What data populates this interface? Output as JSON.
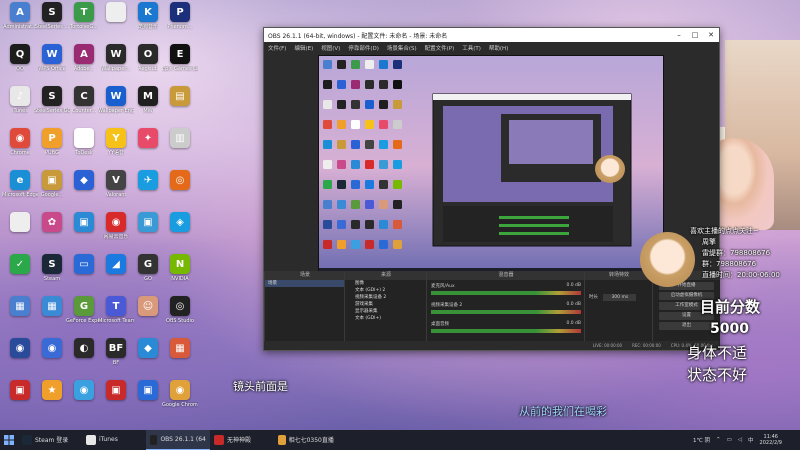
{
  "desktop": {
    "icons": [
      {
        "label": "Administrat...",
        "color": "#4a7fd0",
        "glyph": "A"
      },
      {
        "label": "SteelSeries ...",
        "color": "#222",
        "glyph": "S"
      },
      {
        "label": "TortoiseG...",
        "color": "#3b9b4a",
        "glyph": "T"
      },
      {
        "label": "",
        "color": "#eeeeee",
        "glyph": ""
      },
      {
        "label": "酷狗音乐",
        "color": "#1a78d0",
        "glyph": "K"
      },
      {
        "label": "Phenom...",
        "color": "#1b2f7a",
        "glyph": "P"
      },
      {
        "label": "QQ",
        "color": "#1d1d1d",
        "glyph": "Q"
      },
      {
        "label": "WPS Office",
        "color": "#2a62d6",
        "glyph": "W"
      },
      {
        "label": "Adobe...",
        "color": "#9a2a72",
        "glyph": "A"
      },
      {
        "label": "Wallpaper...",
        "color": "#2b2b2b",
        "glyph": "W"
      },
      {
        "label": "Aegisub",
        "color": "#2a2a2a",
        "glyph": "O"
      },
      {
        "label": "Epic Games Launcher",
        "color": "#111111",
        "glyph": "E"
      },
      {
        "label": "iTunes",
        "color": "#e8e8e8",
        "glyph": "♪"
      },
      {
        "label": "SteelSeries GG",
        "color": "#222222",
        "glyph": "S"
      },
      {
        "label": "Counter...",
        "color": "#333333",
        "glyph": "C"
      },
      {
        "label": "Wallpaper Engine",
        "color": "#1a5fd0",
        "glyph": "W"
      },
      {
        "label": "MW",
        "color": "#202020",
        "glyph": "M"
      },
      {
        "label": "",
        "color": "#c89a3a",
        "glyph": "▤"
      },
      {
        "label": "Chrome",
        "color": "#e04a3a",
        "glyph": "◉"
      },
      {
        "label": "PUBG",
        "color": "#f0a02a",
        "glyph": "P"
      },
      {
        "label": "ToDesk",
        "color": "#ffffff",
        "glyph": "▣"
      },
      {
        "label": "YY语音",
        "color": "#f6c21a",
        "glyph": "Y"
      },
      {
        "label": "",
        "color": "#e84a6a",
        "glyph": "✦"
      },
      {
        "label": "",
        "color": "#cccccc",
        "glyph": "▥"
      },
      {
        "label": "Microsoft Edge",
        "color": "#1b8fd6",
        "glyph": "e"
      },
      {
        "label": "Google...",
        "color": "#c89a3a",
        "glyph": "▣"
      },
      {
        "label": "",
        "color": "#2a62d6",
        "glyph": "◆"
      },
      {
        "label": "Valorant",
        "color": "#444444",
        "glyph": "V"
      },
      {
        "label": "",
        "color": "#1a9ce0",
        "glyph": "✈"
      },
      {
        "label": "",
        "color": "#e46a1a",
        "glyph": "◎"
      },
      {
        "label": "",
        "color": "#eeeeee",
        "glyph": ""
      },
      {
        "label": "",
        "color": "#c94a8a",
        "glyph": "✿"
      },
      {
        "label": "",
        "color": "#2a8ad6",
        "glyph": "▣"
      },
      {
        "label": "网易云音乐",
        "color": "#d82a2a",
        "glyph": "◉"
      },
      {
        "label": "",
        "color": "#3a9ad6",
        "glyph": "▣"
      },
      {
        "label": "",
        "color": "#1a9ce0",
        "glyph": "◈"
      },
      {
        "label": "",
        "color": "#2aa84a",
        "glyph": "✓"
      },
      {
        "label": "Steam",
        "color": "#1b2838",
        "glyph": "S"
      },
      {
        "label": "",
        "color": "#2a6ad6",
        "glyph": "▭"
      },
      {
        "label": "",
        "color": "#1a7ae0",
        "glyph": "◢"
      },
      {
        "label": "GO",
        "color": "#333333",
        "glyph": "G"
      },
      {
        "label": "NVIDIA",
        "color": "#76b900",
        "glyph": "N"
      },
      {
        "label": "",
        "color": "#4a7fd0",
        "glyph": "▦"
      },
      {
        "label": "",
        "color": "#3a8ad6",
        "glyph": "▦"
      },
      {
        "label": "GeForce Experience",
        "color": "#5a9a3a",
        "glyph": "G"
      },
      {
        "label": "Microsoft Teams",
        "color": "#4a5ad6",
        "glyph": "T"
      },
      {
        "label": "",
        "color": "#d89a7a",
        "glyph": "☺"
      },
      {
        "label": "OBS Studio",
        "color": "#222222",
        "glyph": "◎"
      },
      {
        "label": "",
        "color": "#2a4a9a",
        "glyph": "◉"
      },
      {
        "label": "",
        "color": "#3a6ad6",
        "glyph": "◉"
      },
      {
        "label": "",
        "color": "#2a2a2a",
        "glyph": "◐"
      },
      {
        "label": "BF",
        "color": "#2a2a2a",
        "glyph": "BF"
      },
      {
        "label": "",
        "color": "#2a8ad6",
        "glyph": "◆"
      },
      {
        "label": "",
        "color": "#d85a3a",
        "glyph": "▦"
      },
      {
        "label": "",
        "color": "#c82a2a",
        "glyph": "▣"
      },
      {
        "label": "",
        "color": "#f0a02a",
        "glyph": "★"
      },
      {
        "label": "",
        "color": "#3aa0e0",
        "glyph": "◉"
      },
      {
        "label": "",
        "color": "#c82a2a",
        "glyph": "▣"
      },
      {
        "label": "",
        "color": "#2a6ad6",
        "glyph": "▣"
      },
      {
        "label": "Google Chrome",
        "color": "#e0a03a",
        "glyph": "◉"
      }
    ]
  },
  "obs": {
    "title": "OBS 26.1.1 (64-bit, windows) - 配置文件: 未命名 - 场景: 未命名",
    "menu": [
      "文件(F)",
      "编辑(E)",
      "视图(V)",
      "停靠部件(D)",
      "场景集合(S)",
      "配置文件(P)",
      "工具(T)",
      "帮助(H)"
    ],
    "docks": {
      "scenes_title": "场景",
      "scene_item": "场景",
      "sources_title": "来源",
      "sources": [
        "图像",
        "文本 (GDI+) 2",
        "视频采集设备 2",
        "游戏采集",
        "显示器采集",
        "文本 (GDI+)"
      ],
      "mixer_title": "混音器",
      "mixer": [
        {
          "name": "麦克风/Aux",
          "db": "0.0 dB"
        },
        {
          "name": "视频采集设备 2",
          "db": "0.0 dB"
        },
        {
          "name": "桌面音频",
          "db": "0.0 dB"
        }
      ],
      "transition_title": "转场特效",
      "transition_duration_label": "时长",
      "transition_duration": "300 ms",
      "controls_title": "控件",
      "controls": [
        "开始直播",
        "启动虚拟摄像机",
        "工作室模式",
        "设置",
        "退出"
      ]
    },
    "status": {
      "live": "LIVE: 00:00:00",
      "rec": "REC: 00:00:00",
      "cpu": "CPU: 0.4%, 60.00 fps"
    }
  },
  "overlay": {
    "chat": [
      "喜欢主播的点点关注~",
      "周擎",
      "雷缇群：798808676",
      "群：798808676",
      "直播时间：20:00-06:00"
    ],
    "score_label": "目前分数",
    "score_value": "5000",
    "status_line1": "身体不适",
    "status_line2": "状态不好"
  },
  "captions": {
    "left": "镜头前面是",
    "center": "从前的我们在喝彩"
  },
  "taskbar": {
    "items": [
      {
        "label": "Steam 登录",
        "color": "#1b2838",
        "active": false
      },
      {
        "label": "iTunes",
        "color": "#e8e8e8",
        "active": false
      },
      {
        "label": "OBS 26.1.1 (64-bit...",
        "color": "#222222",
        "active": true
      },
      {
        "label": "无神神殿",
        "color": "#c82a2a",
        "active": false
      },
      {
        "label": "相七七0350直播_点...",
        "color": "#e0a03a",
        "active": false
      }
    ],
    "weather": "1℃ 阴",
    "time": "11:46",
    "date": "2022/2/9"
  }
}
